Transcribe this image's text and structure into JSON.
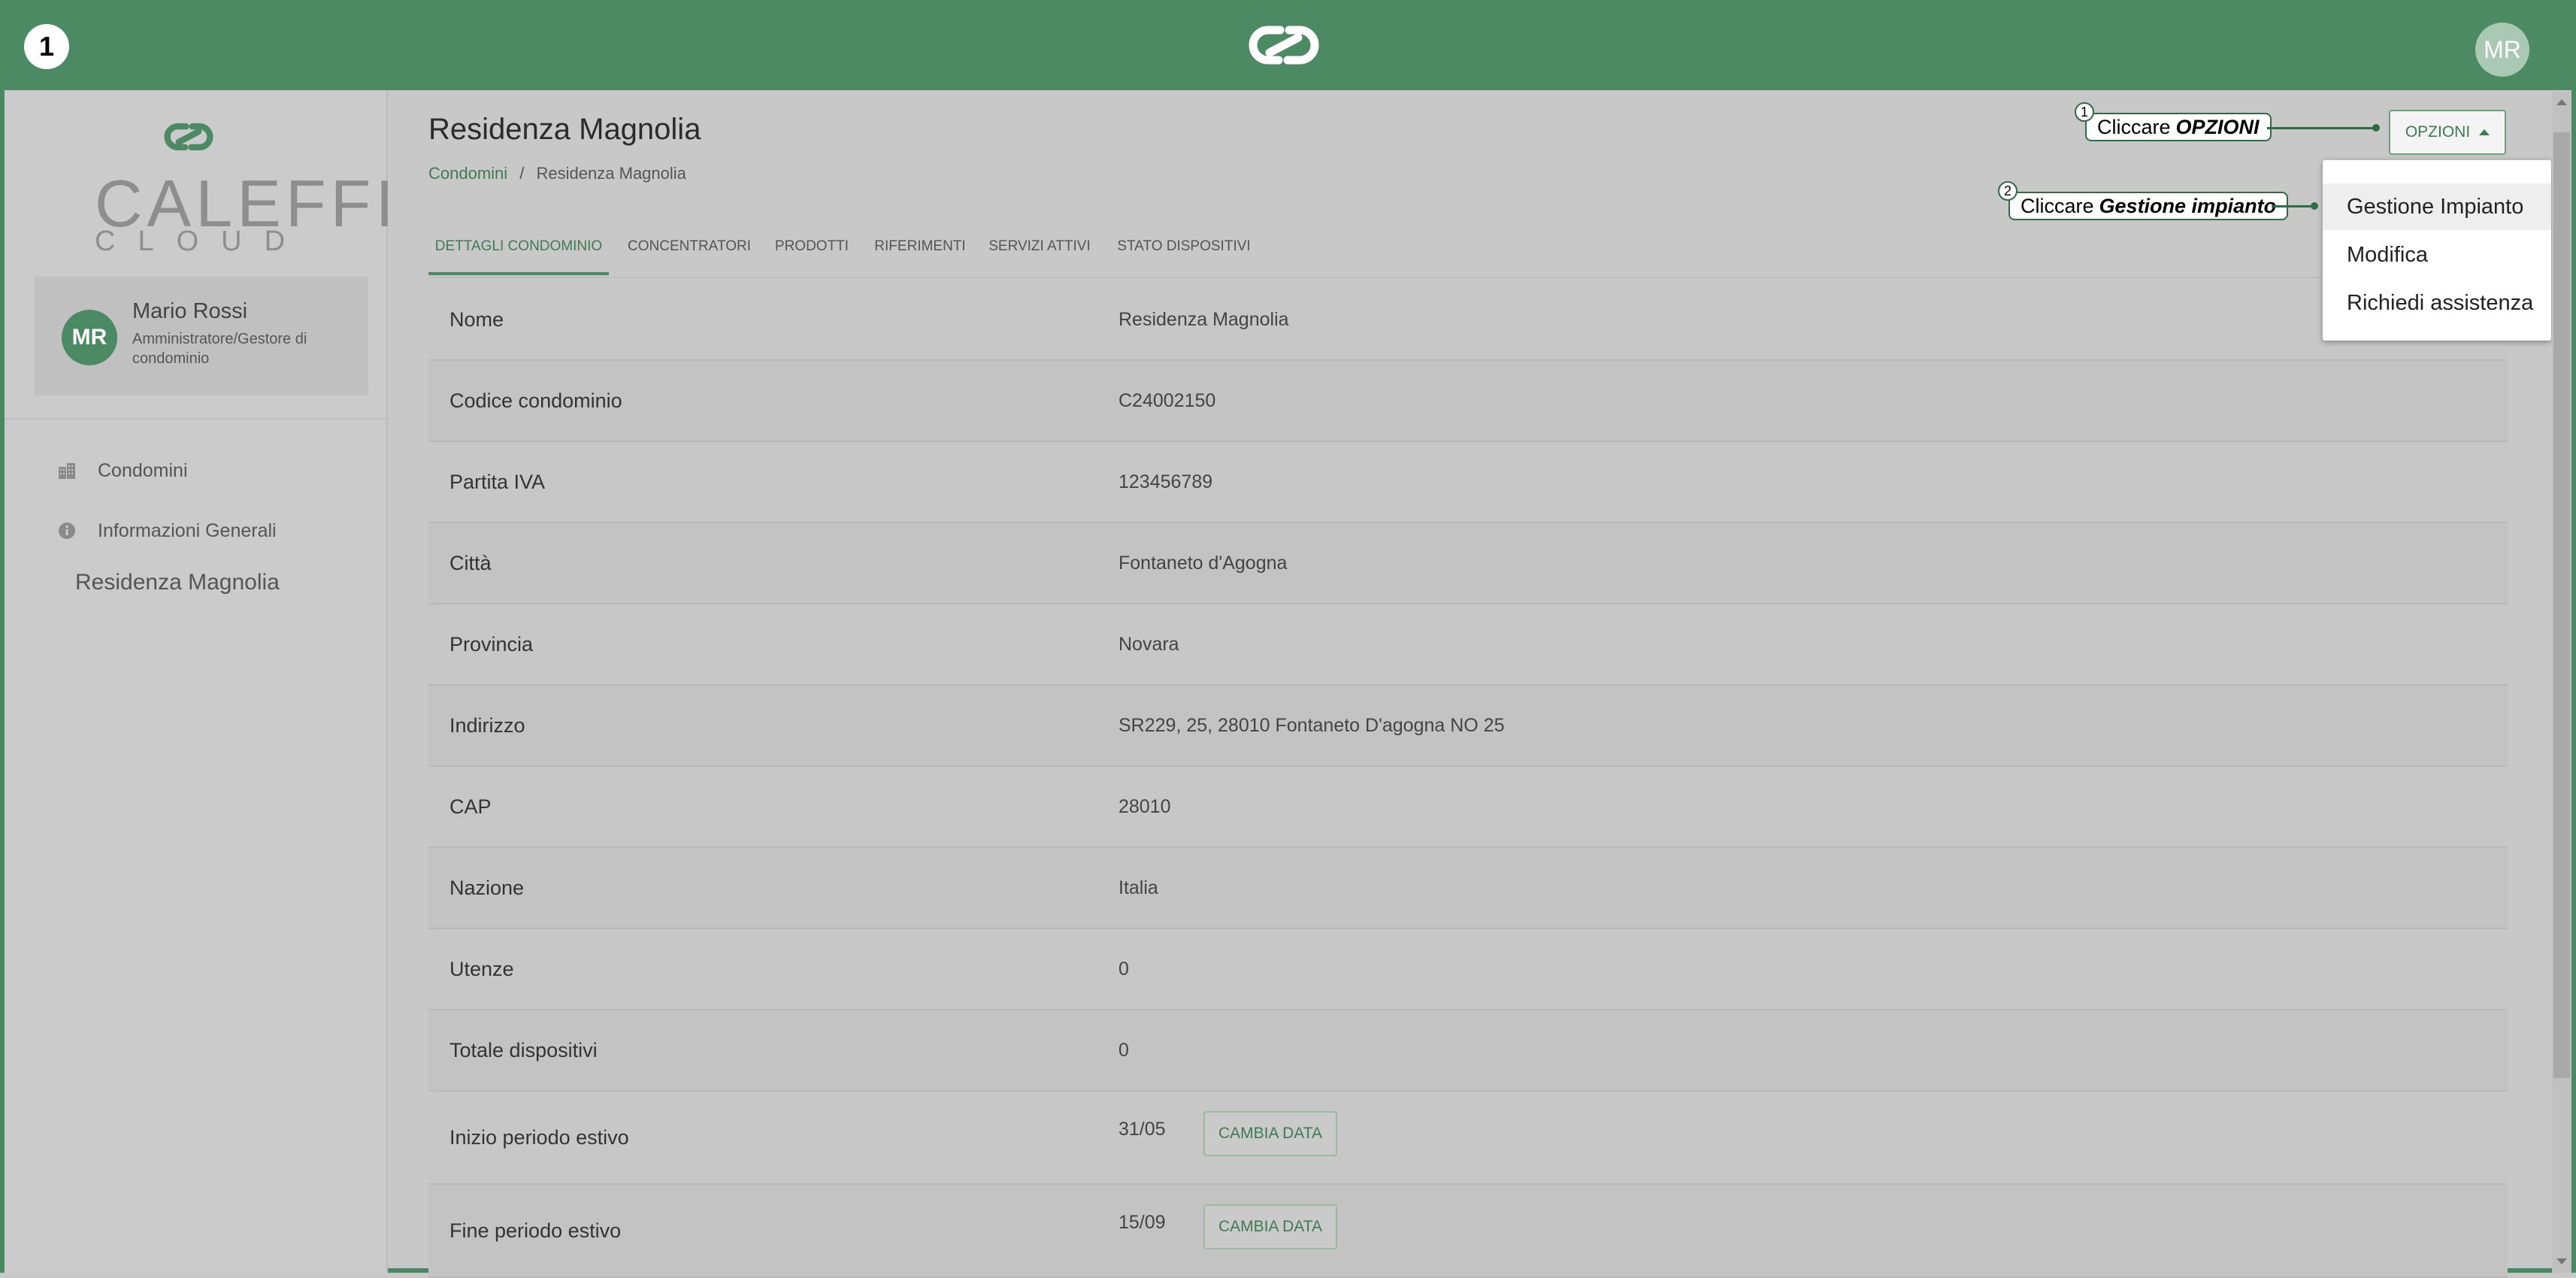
{
  "step_badge": "1",
  "topbar": {
    "avatar_initials": "MR",
    "logo_icon": "caleffi-link-logo-icon"
  },
  "sidebar": {
    "brand_line1": "CALEFFI",
    "brand_line2": "CLOUD",
    "user": {
      "initials": "MR",
      "name": "Mario Rossi",
      "role": "Amministratore/Gestore di condominio"
    },
    "nav": [
      {
        "label": "Condomini",
        "icon": "building-icon"
      },
      {
        "label": "Informazioni Generali",
        "icon": "info-icon"
      }
    ],
    "sub_item": "Residenza Magnolia"
  },
  "page": {
    "title": "Residenza Magnolia",
    "breadcrumb": {
      "link": "Condomini",
      "separator": "/",
      "current": "Residenza Magnolia"
    }
  },
  "tabs": [
    {
      "label": "DETTAGLI CONDOMINIO",
      "active": true
    },
    {
      "label": "CONCENTRATORI",
      "active": false
    },
    {
      "label": "PRODOTTI",
      "active": false
    },
    {
      "label": "RIFERIMENTI",
      "active": false
    },
    {
      "label": "SERVIZI ATTIVI",
      "active": false
    },
    {
      "label": "STATO DISPOSITIVI",
      "active": false
    }
  ],
  "details": [
    {
      "label": "Nome",
      "value": "Residenza Magnolia"
    },
    {
      "label": "Codice condominio",
      "value": "C24002150"
    },
    {
      "label": "Partita IVA",
      "value": "123456789"
    },
    {
      "label": "Città",
      "value": "Fontaneto d'Agogna"
    },
    {
      "label": "Provincia",
      "value": "Novara"
    },
    {
      "label": "Indirizzo",
      "value": "SR229, 25, 28010 Fontaneto D'agogna NO 25"
    },
    {
      "label": "CAP",
      "value": "28010"
    },
    {
      "label": "Nazione",
      "value": "Italia"
    },
    {
      "label": "Utenze",
      "value": "0"
    },
    {
      "label": "Totale dispositivi",
      "value": "0"
    },
    {
      "label": "Inizio periodo estivo",
      "value": "31/05",
      "button": "CAMBIA DATA"
    },
    {
      "label": "Fine periodo estivo",
      "value": "15/09",
      "button": "CAMBIA DATA"
    }
  ],
  "options": {
    "button_label": "OPZIONI",
    "menu": [
      "Gestione Impianto",
      "Modifica",
      "Richiedi assistenza"
    ]
  },
  "callouts": [
    {
      "num": "1",
      "text": "Cliccare",
      "bold": "OPZIONI"
    },
    {
      "num": "2",
      "text": "Cliccare",
      "bold": "Gestione impianto"
    }
  ],
  "colors": {
    "brand_green": "#4c8a63",
    "overlay_gray": "#c8c8c8",
    "accent_text": "#3f7a55"
  }
}
